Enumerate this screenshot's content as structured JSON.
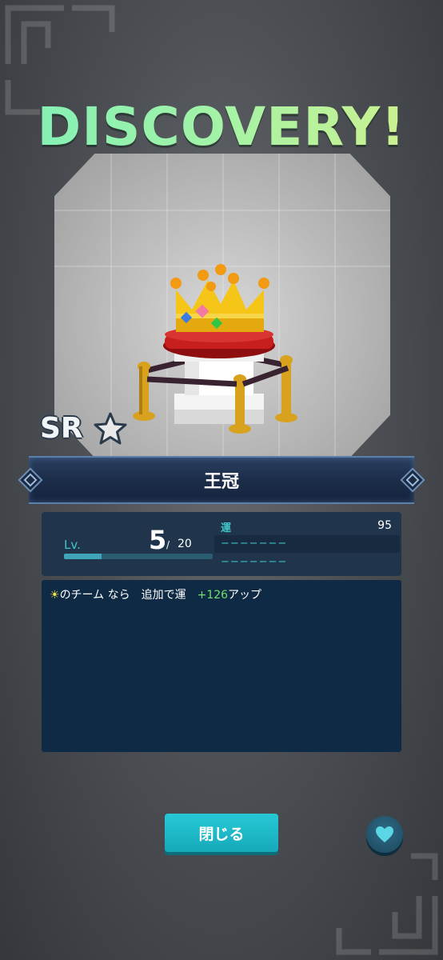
{
  "title": "DISCOVERY!",
  "rarity": {
    "label": "SR",
    "stars": 1
  },
  "item": {
    "name": "王冠"
  },
  "level": {
    "label": "Lv.",
    "current": "5",
    "separator": "/",
    "max": "20",
    "progress": 0.25
  },
  "stats": [
    {
      "label": "運",
      "value": "95"
    },
    {
      "label": "−−−−−−−",
      "value": ""
    },
    {
      "label": "−−−−−−−",
      "value": ""
    }
  ],
  "description": {
    "sun": "☀",
    "text": "のチーム なら　追加で運　",
    "bonus": "+126",
    "suffix": "アップ"
  },
  "buttons": {
    "close_label": "閉じる"
  },
  "icons": {
    "favorite": "heart-icon",
    "rarity_star": "star-icon"
  },
  "colors": {
    "accent": "#1fbccb",
    "label": "#3fc5c8",
    "bonus": "#6fe06a",
    "title_start": "#7ff0b8",
    "title_end": "#d4f08c"
  }
}
